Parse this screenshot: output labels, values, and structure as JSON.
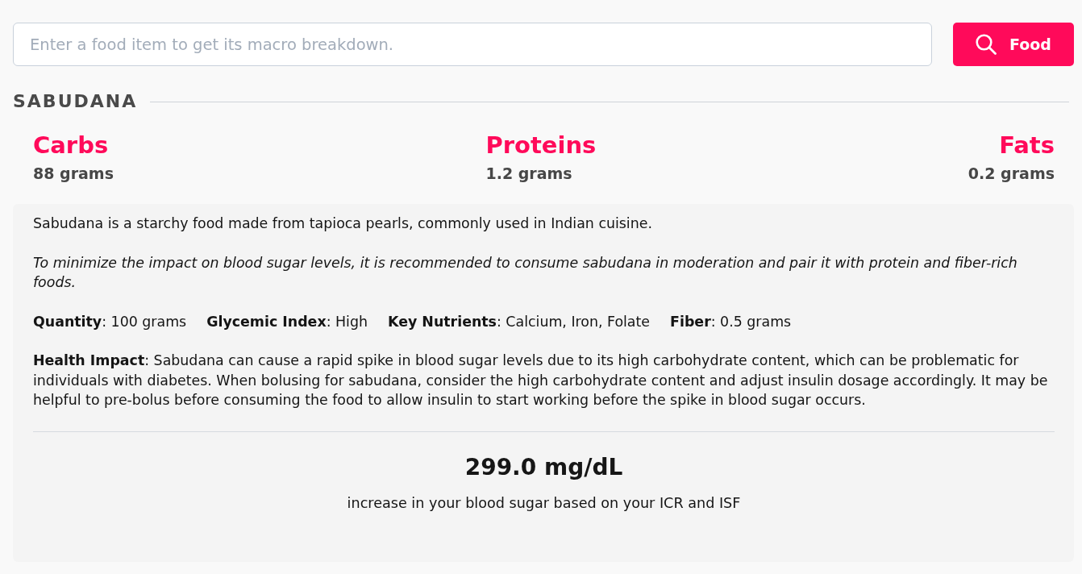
{
  "search": {
    "placeholder": "Enter a food item to get its macro breakdown.",
    "button": "Food"
  },
  "food": {
    "name": "SABUDANA"
  },
  "macros": [
    {
      "label": "Carbs",
      "value": "88 grams"
    },
    {
      "label": "Proteins",
      "value": "1.2 grams"
    },
    {
      "label": "Fats",
      "value": "0.2 grams"
    }
  ],
  "details": {
    "description": "Sabudana is a starchy food made from tapioca pearls, commonly used in Indian cuisine.",
    "tip": "To minimize the impact on blood sugar levels, it is recommended to consume sabudana in moderation and pair it with protein and fiber-rich foods.",
    "facts": [
      "**Quantity**: 100 grams",
      "**Glycemic Index**: High",
      "**Key Nutrients**: Calcium, Iron, Folate",
      "**Fiber**: 0.5 grams"
    ],
    "health_impact": "**Health Impact**: Sabudana can cause a rapid spike in blood sugar levels due to its high carbohydrate content, which can be problematic for individuals with diabetes. When bolusing for sabudana, consider the high carbohydrate content and adjust insulin dosage accordingly. It may be helpful to pre-bolus before consuming the food to allow insulin to start working before the spike in blood sugar occurs."
  },
  "result": {
    "value": "299.0 mg/dL",
    "caption": "increase in your blood sugar based on your ICR and ISF"
  }
}
